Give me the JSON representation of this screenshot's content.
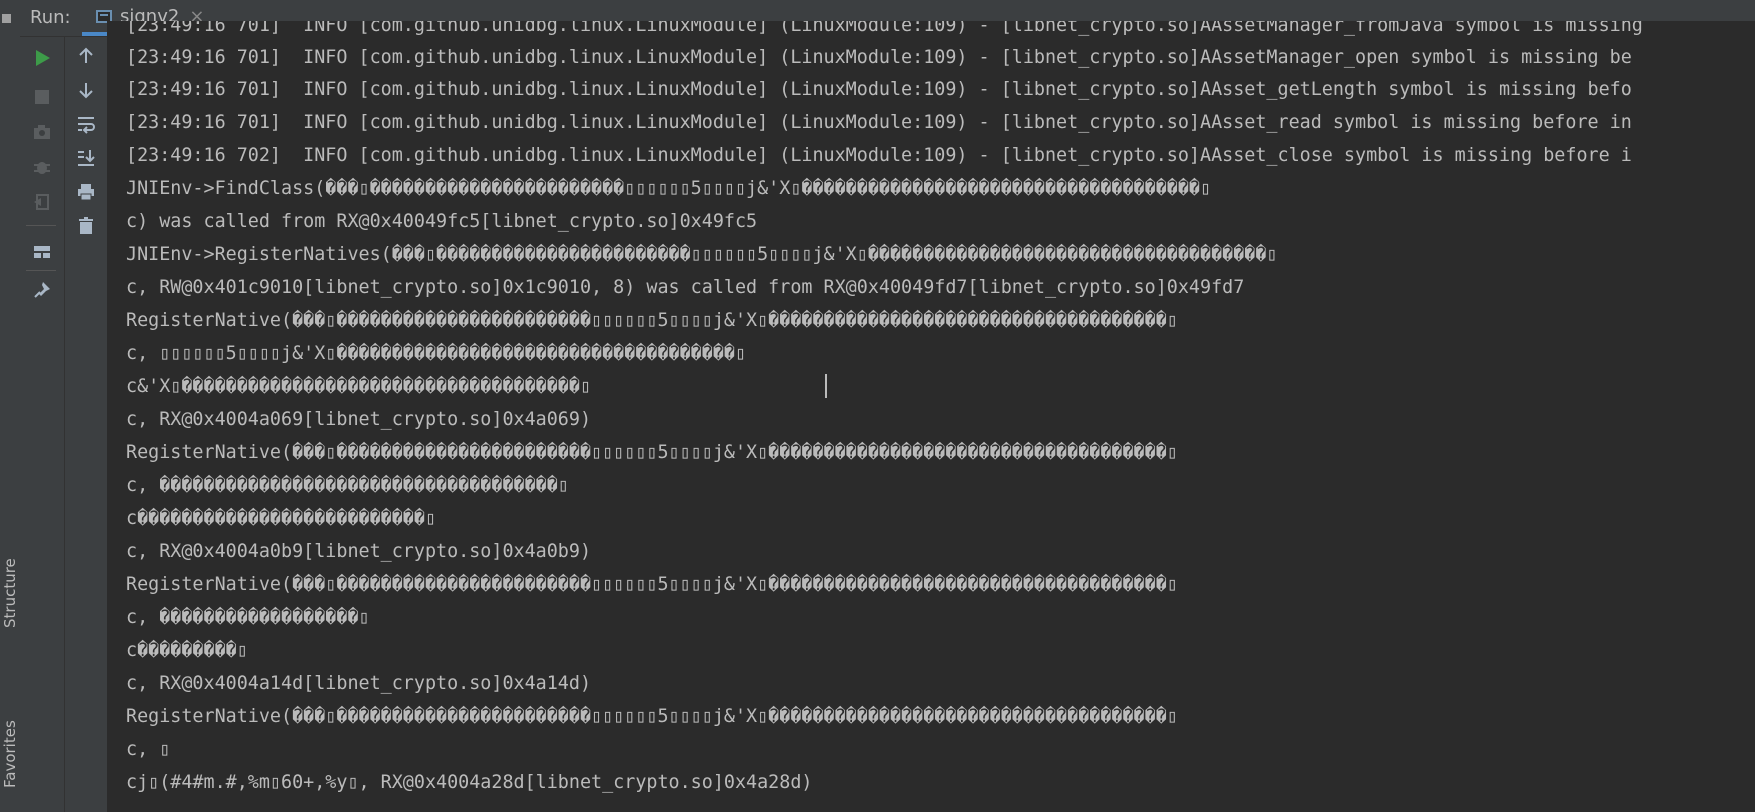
{
  "sidebar": {
    "structure_label": "Structure",
    "favorites_label": "Favorites"
  },
  "header": {
    "run_label": "Run:",
    "tab_title": "signv2",
    "tab_close": "×"
  },
  "toolbar": {
    "buttons": [
      "rerun-icon",
      "stop-icon",
      "snapshot-icon",
      "debug-icon",
      "exit-icon",
      "layout-icon",
      "pin-icon"
    ],
    "secondary_buttons": [
      "arrow-up-icon",
      "arrow-down-icon",
      "soft-wrap-icon",
      "scroll-to-end-icon",
      "print-icon",
      "trash-icon"
    ],
    "accent_color": "#3d9b49"
  },
  "console": {
    "lines": [
      "[23:49:16 701]  INFO [com.github.unidbg.linux.LinuxModule] (LinuxModule:109) - [libnet_crypto.so]AAssetManager_fromJava symbol is missing",
      "[23:49:16 701]  INFO [com.github.unidbg.linux.LinuxModule] (LinuxModule:109) - [libnet_crypto.so]AAssetManager_open symbol is missing be",
      "[23:49:16 701]  INFO [com.github.unidbg.linux.LinuxModule] (LinuxModule:109) - [libnet_crypto.so]AAsset_getLength symbol is missing befo",
      "[23:49:16 701]  INFO [com.github.unidbg.linux.LinuxModule] (LinuxModule:109) - [libnet_crypto.so]AAsset_read symbol is missing before in",
      "[23:49:16 702]  INFO [com.github.unidbg.linux.LinuxModule] (LinuxModule:109) - [libnet_crypto.so]AAsset_close symbol is missing before i",
      "JNIEnv->FindClass(���▯�����������������������▯▯▯▯▯▯5▯▯▯▯j&'X▯������������������������������������▯",
      "c) was called from RX@0x40049fc5[libnet_crypto.so]0x49fc5",
      "JNIEnv->RegisterNatives(���▯�����������������������▯▯▯▯▯▯5▯▯▯▯j&'X▯������������������������������������▯",
      "c, RW@0x401c9010[libnet_crypto.so]0x1c9010, 8) was called from RX@0x40049fd7[libnet_crypto.so]0x49fd7",
      "RegisterNative(���▯�����������������������▯▯▯▯▯▯5▯▯▯▯j&'X▯������������������������������������▯",
      "c, ▯▯▯▯▯▯5▯▯▯▯j&'X▯������������������������������������▯",
      "c&'X▯������������������������������������▯",
      "c, RX@0x4004a069[libnet_crypto.so]0x4a069)",
      "RegisterNative(���▯�����������������������▯▯▯▯▯▯5▯▯▯▯j&'X▯������������������������������������▯",
      "c, ������������������������������������▯",
      "c��������������������������▯",
      "c, RX@0x4004a0b9[libnet_crypto.so]0x4a0b9)",
      "RegisterNative(���▯�����������������������▯▯▯▯▯▯5▯▯▯▯j&'X▯������������������������������������▯",
      "c, ������������������▯",
      "c���������▯",
      "c, RX@0x4004a14d[libnet_crypto.so]0x4a14d)",
      "RegisterNative(���▯�����������������������▯▯▯▯▯▯5▯▯▯▯j&'X▯������������������������������������▯",
      "c, ▯",
      "cj▯(#4#m.#,%m▯60+,%y▯, RX@0x4004a28d[libnet_crypto.so]0x4a28d)"
    ]
  }
}
